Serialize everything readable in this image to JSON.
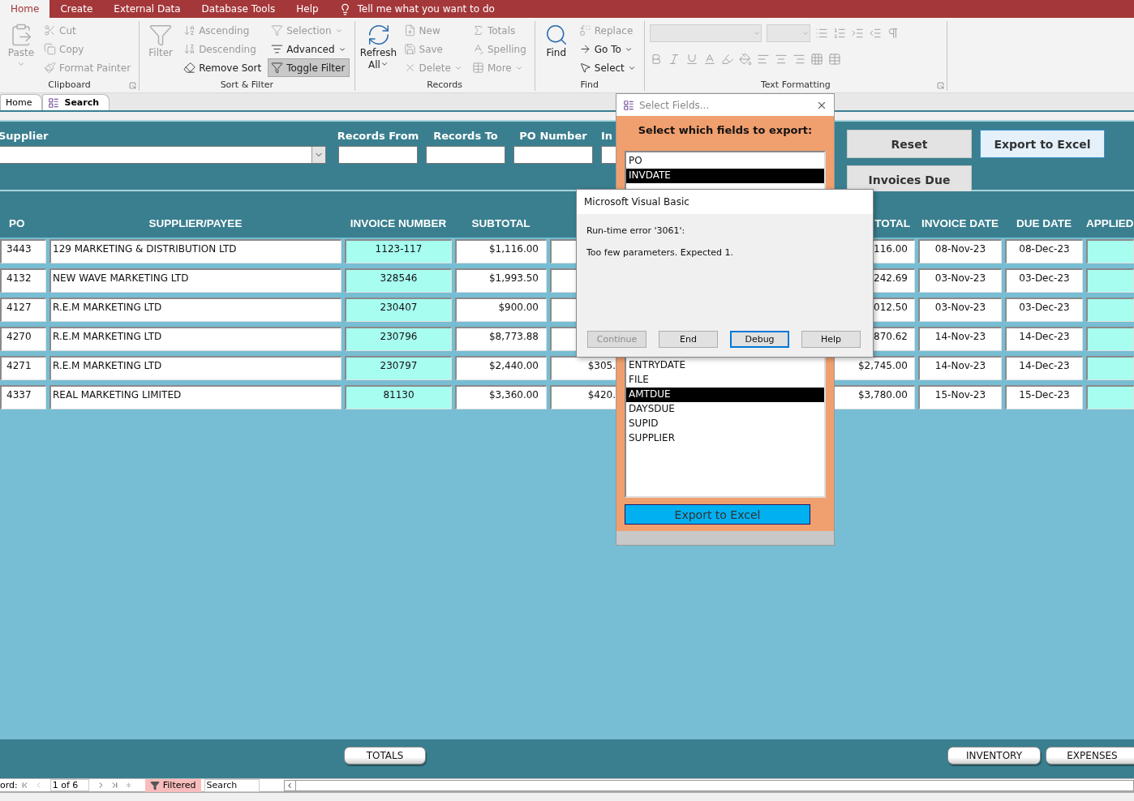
{
  "menu_tabs": [
    {
      "label": "Home",
      "selected": true
    },
    {
      "label": "Create",
      "selected": false
    },
    {
      "label": "External Data",
      "selected": false
    },
    {
      "label": "Database Tools",
      "selected": false
    },
    {
      "label": "Help",
      "selected": false
    }
  ],
  "tell_me": "Tell me what you want to do",
  "ribbon": [
    {
      "kind": "commands",
      "title": "Clipboard",
      "launcher": true,
      "items": [
        {
          "label": "Paste",
          "kind": "large",
          "disabled": true,
          "dropdown": true,
          "pressed": false
        },
        {
          "label": "Cut",
          "kind": "small",
          "disabled": true,
          "dropdown": false,
          "pressed": false
        },
        {
          "label": "Copy",
          "kind": "small",
          "disabled": true,
          "dropdown": false,
          "pressed": false
        },
        {
          "label": "Format Painter",
          "kind": "small",
          "disabled": true,
          "dropdown": false,
          "pressed": false
        }
      ]
    },
    {
      "kind": "commands",
      "title": "Sort & Filter",
      "items": [
        {
          "label": "Filter",
          "kind": "large",
          "disabled": true,
          "dropdown": false,
          "pressed": false
        },
        {
          "label": "Ascending",
          "kind": "small",
          "disabled": true,
          "dropdown": false,
          "pressed": false
        },
        {
          "label": "Descending",
          "kind": "small",
          "disabled": true,
          "dropdown": false,
          "pressed": false
        },
        {
          "label": "Remove Sort",
          "kind": "small",
          "disabled": false,
          "dropdown": false,
          "pressed": false
        },
        {
          "label": "Selection",
          "kind": "small",
          "disabled": true,
          "dropdown": true,
          "pressed": false
        },
        {
          "label": "Advanced",
          "kind": "small",
          "disabled": false,
          "dropdown": true,
          "pressed": false
        },
        {
          "label": "Toggle Filter",
          "kind": "small",
          "disabled": false,
          "dropdown": false,
          "pressed": true
        }
      ]
    },
    {
      "kind": "commands",
      "title": "Records",
      "items": [
        {
          "label": "Refresh All",
          "kind": "large",
          "disabled": false,
          "dropdown": true,
          "pressed": false
        },
        {
          "label": "New",
          "kind": "small",
          "disabled": true,
          "dropdown": false,
          "pressed": false
        },
        {
          "label": "Save",
          "kind": "small",
          "disabled": true,
          "dropdown": false,
          "pressed": false
        },
        {
          "label": "Delete",
          "kind": "small",
          "disabled": true,
          "dropdown": true,
          "pressed": false
        },
        {
          "label": "Totals",
          "kind": "small",
          "disabled": true,
          "dropdown": false,
          "pressed": false
        },
        {
          "label": "Spelling",
          "kind": "small",
          "disabled": true,
          "dropdown": false,
          "pressed": false
        },
        {
          "label": "More",
          "kind": "small",
          "disabled": true,
          "dropdown": true,
          "pressed": false
        }
      ]
    },
    {
      "kind": "commands",
      "title": "Find",
      "items": [
        {
          "label": "Find",
          "kind": "large",
          "disabled": false,
          "dropdown": false,
          "pressed": false
        },
        {
          "label": "Replace",
          "kind": "small",
          "disabled": true,
          "dropdown": false,
          "pressed": false
        },
        {
          "label": "Go To",
          "kind": "small",
          "disabled": false,
          "dropdown": true,
          "pressed": false
        },
        {
          "label": "Select",
          "kind": "small",
          "disabled": false,
          "dropdown": true,
          "pressed": false
        }
      ]
    },
    {
      "kind": "formatting",
      "title": "Text Formatting",
      "launcher": true
    }
  ],
  "doc_tabs": [
    {
      "label": "Home",
      "selected": false
    },
    {
      "label": "Search",
      "selected": true
    }
  ],
  "form_header": {
    "supplier_label": "Supplier",
    "filters": [
      {
        "label": "Records From"
      },
      {
        "label": "Records To"
      },
      {
        "label": "PO Number"
      },
      {
        "label": "In"
      }
    ],
    "buttons": [
      {
        "label": "Reset",
        "highlighted": false
      },
      {
        "label": "Export to Excel",
        "highlighted": true
      },
      {
        "label": "Invoices Due",
        "highlighted": false
      }
    ]
  },
  "table": {
    "headers": {
      "po": "PO",
      "supplier_payee": "SUPPLIER/PAYEE",
      "invoice_number": "INVOICE NUMBER",
      "subtotal": "SUBTOTAL",
      "total": "TOTAL",
      "invoice_date": "INVOICE DATE",
      "due_date": "DUE DATE",
      "applied": "APPLIED"
    },
    "rows": [
      {
        "po": "3443",
        "supplier_payee": "129 MARKETING & DISTRIBUTION LTD",
        "invoice_number": "1123-117",
        "subtotal": "$1,116.00",
        "total": "116.00",
        "invoice_date": "08-Nov-23",
        "due_date": "08-Dec-23"
      },
      {
        "po": "4132",
        "supplier_payee": "NEW WAVE MARKETING LTD",
        "invoice_number": "328546",
        "subtotal": "$1,993.50",
        "total": "242.69",
        "invoice_date": "03-Nov-23",
        "due_date": "03-Dec-23"
      },
      {
        "po": "4127",
        "supplier_payee": "R.E.M MARKETING LTD",
        "invoice_number": "230407",
        "subtotal": "$900.00",
        "total": "012.50",
        "invoice_date": "03-Nov-23",
        "due_date": "03-Dec-23"
      },
      {
        "po": "4270",
        "supplier_payee": "R.E.M MARKETING LTD",
        "invoice_number": "230796",
        "subtotal": "$8,773.88",
        "total": "870.62",
        "invoice_date": "14-Nov-23",
        "due_date": "14-Dec-23"
      },
      {
        "po": "4271",
        "supplier_payee": "R.E.M MARKETING LTD",
        "invoice_number": "230797",
        "subtotal": "$2,440.00",
        "column_5": "$305.",
        "total": "$2,745.00",
        "invoice_date": "14-Nov-23",
        "due_date": "14-Dec-23"
      },
      {
        "po": "4337",
        "supplier_payee": "REAL MARKETING LIMITED",
        "invoice_number": "81130",
        "subtotal": "$3,360.00",
        "column_5": "$420.",
        "total": "$3,780.00",
        "invoice_date": "15-Nov-23",
        "due_date": "15-Dec-23"
      }
    ]
  },
  "footer": {
    "center_buttons": [
      "TOTALS"
    ],
    "right_buttons": [
      "INVENTORY",
      "EXPENSES"
    ]
  },
  "nav_bar": {
    "record_label": "ord:",
    "position": "1 of 6",
    "filter_status": "Filtered",
    "filtered": true,
    "search_placeholder": "Search"
  },
  "select_fields_window": {
    "title": "Select Fields...",
    "heading": "Select which fields to export:",
    "fields_upper": [
      {
        "label": "PO",
        "selected": false
      },
      {
        "label": "INVDATE",
        "selected": true
      }
    ],
    "fields_lower": [
      {
        "label": "ENTRYDATE",
        "selected": false
      },
      {
        "label": "FILE",
        "selected": false
      },
      {
        "label": "AMTDUE",
        "selected": true
      },
      {
        "label": "DAYSDUE",
        "selected": false
      },
      {
        "label": "SUPID",
        "selected": false
      },
      {
        "label": "SUPPLIER",
        "selected": false
      }
    ],
    "export_button": "Export to Excel"
  },
  "error_dialog": {
    "title": "Microsoft Visual Basic",
    "error": "Run-time error '3061':",
    "message": "Too few parameters. Expected 1.",
    "buttons": [
      {
        "label": "Continue",
        "disabled": true,
        "focused": false
      },
      {
        "label": "End",
        "disabled": false,
        "focused": false
      },
      {
        "label": "Debug",
        "disabled": false,
        "focused": true
      },
      {
        "label": "Help",
        "disabled": false,
        "focused": false
      }
    ]
  }
}
